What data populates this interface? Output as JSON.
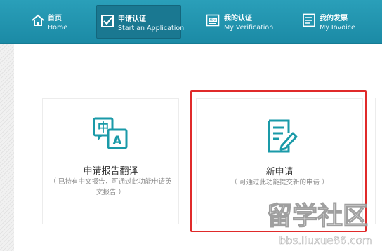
{
  "nav": [
    {
      "cn": "首页",
      "en": "Home",
      "icon": "home-icon",
      "active": false
    },
    {
      "cn": "申请认证",
      "en": "Start an Application",
      "icon": "checkbox-icon",
      "active": true
    },
    {
      "cn": "我的认证",
      "en": "My Verification",
      "icon": "certificate-icon",
      "active": false
    },
    {
      "cn": "我的发票",
      "en": "My Invoice",
      "icon": "invoice-icon",
      "active": false
    }
  ],
  "cards": [
    {
      "title": "申请报告翻译",
      "desc": "（ 已持有中文报告，可通过此功能申请英文报告 ）",
      "icon": "translate-icon"
    },
    {
      "title": "新申请",
      "desc": "（ 可通过此功能提交新的申请 ）",
      "icon": "edit-document-icon"
    }
  ],
  "watermark": {
    "main": "留学社区",
    "url": "bbs.liuxue86.com"
  },
  "colors": {
    "nav_bg": "#2197b2",
    "accent": "#1a9aa8",
    "highlight": "#e02a2a"
  }
}
